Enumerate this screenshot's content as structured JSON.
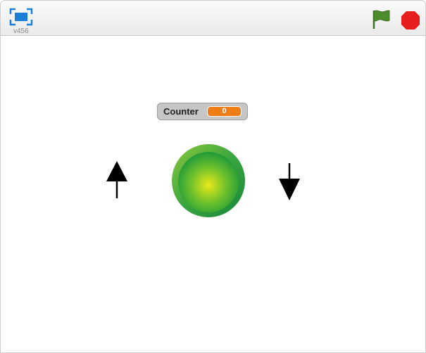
{
  "player": {
    "version": "v456",
    "fullscreen_icon": "fullscreen-icon",
    "green_flag_icon": "green-flag-icon",
    "stop_icon": "stop-sign-icon"
  },
  "stage": {
    "monitor": {
      "label": "Counter",
      "value": "0"
    },
    "sprites": [
      {
        "name": "up-arrow-sprite",
        "icon": "arrow-up-icon"
      },
      {
        "name": "green-ball-sprite",
        "icon": "green-ball-icon"
      },
      {
        "name": "down-arrow-sprite",
        "icon": "arrow-down-icon"
      }
    ]
  },
  "colors": {
    "monitor_value_bg": "#ee7d16",
    "flag_green": "#4c8c2b",
    "stop_red": "#e61e1e",
    "fullscreen_blue": "#1a7fd6"
  }
}
